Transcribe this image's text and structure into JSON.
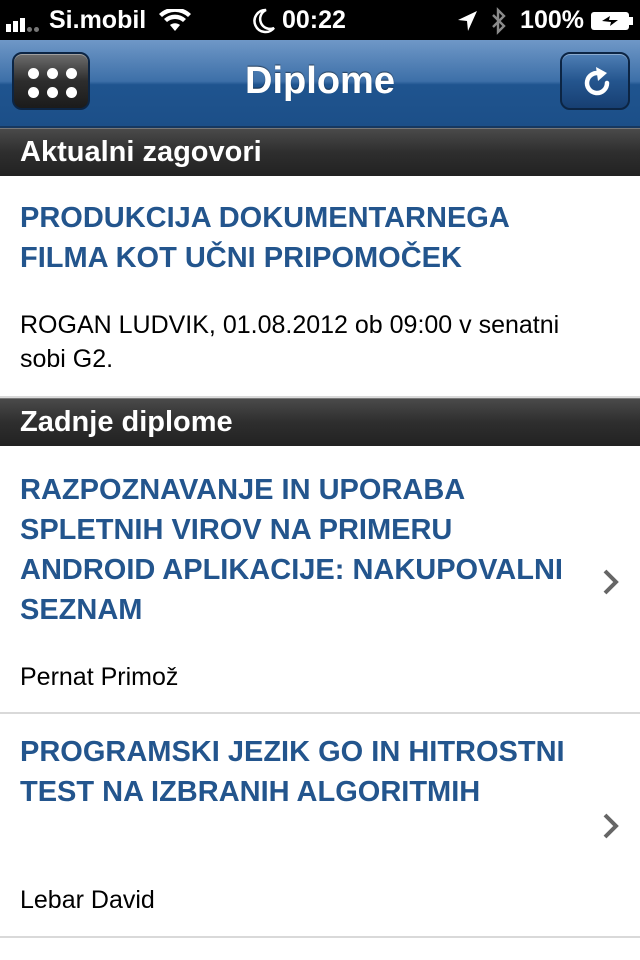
{
  "status_bar": {
    "carrier": "Si.mobil",
    "time": "00:22",
    "battery": "100%"
  },
  "nav": {
    "title": "Diplome"
  },
  "sections": [
    {
      "header": "Aktualni zagovori",
      "items": [
        {
          "title": "PRODUKCIJA DOKUMENTARNEGA FILMA KOT UČNI PRIPOMOČEK",
          "subtitle": "ROGAN LUDVIK, 01.08.2012 ob 09:00 v senatni sobi G2."
        }
      ]
    },
    {
      "header": "Zadnje diplome",
      "items": [
        {
          "title": "RAZPOZNAVANJE IN UPORABA SPLETNIH VIROV NA PRIMERU ANDROID APLIKACIJE: NAKUPOVALNI SEZNAM",
          "subtitle": "Pernat Primož"
        },
        {
          "title": "PROGRAMSKI JEZIK GO IN HITROSTNI TEST NA IZBRANIH ALGORITMIH",
          "subtitle": "Lebar David"
        }
      ]
    }
  ],
  "icons": {
    "menu": "grid-dots-icon",
    "refresh": "refresh-icon",
    "chevron": "chevron-right-icon",
    "wifi": "wifi-icon",
    "moon": "moon-icon",
    "location": "location-arrow-icon",
    "bluetooth": "bluetooth-icon",
    "battery": "battery-icon"
  },
  "colors": {
    "nav_blue": "#1f548f",
    "title_blue": "#23558d",
    "section_dark": "#2e2e2e"
  }
}
